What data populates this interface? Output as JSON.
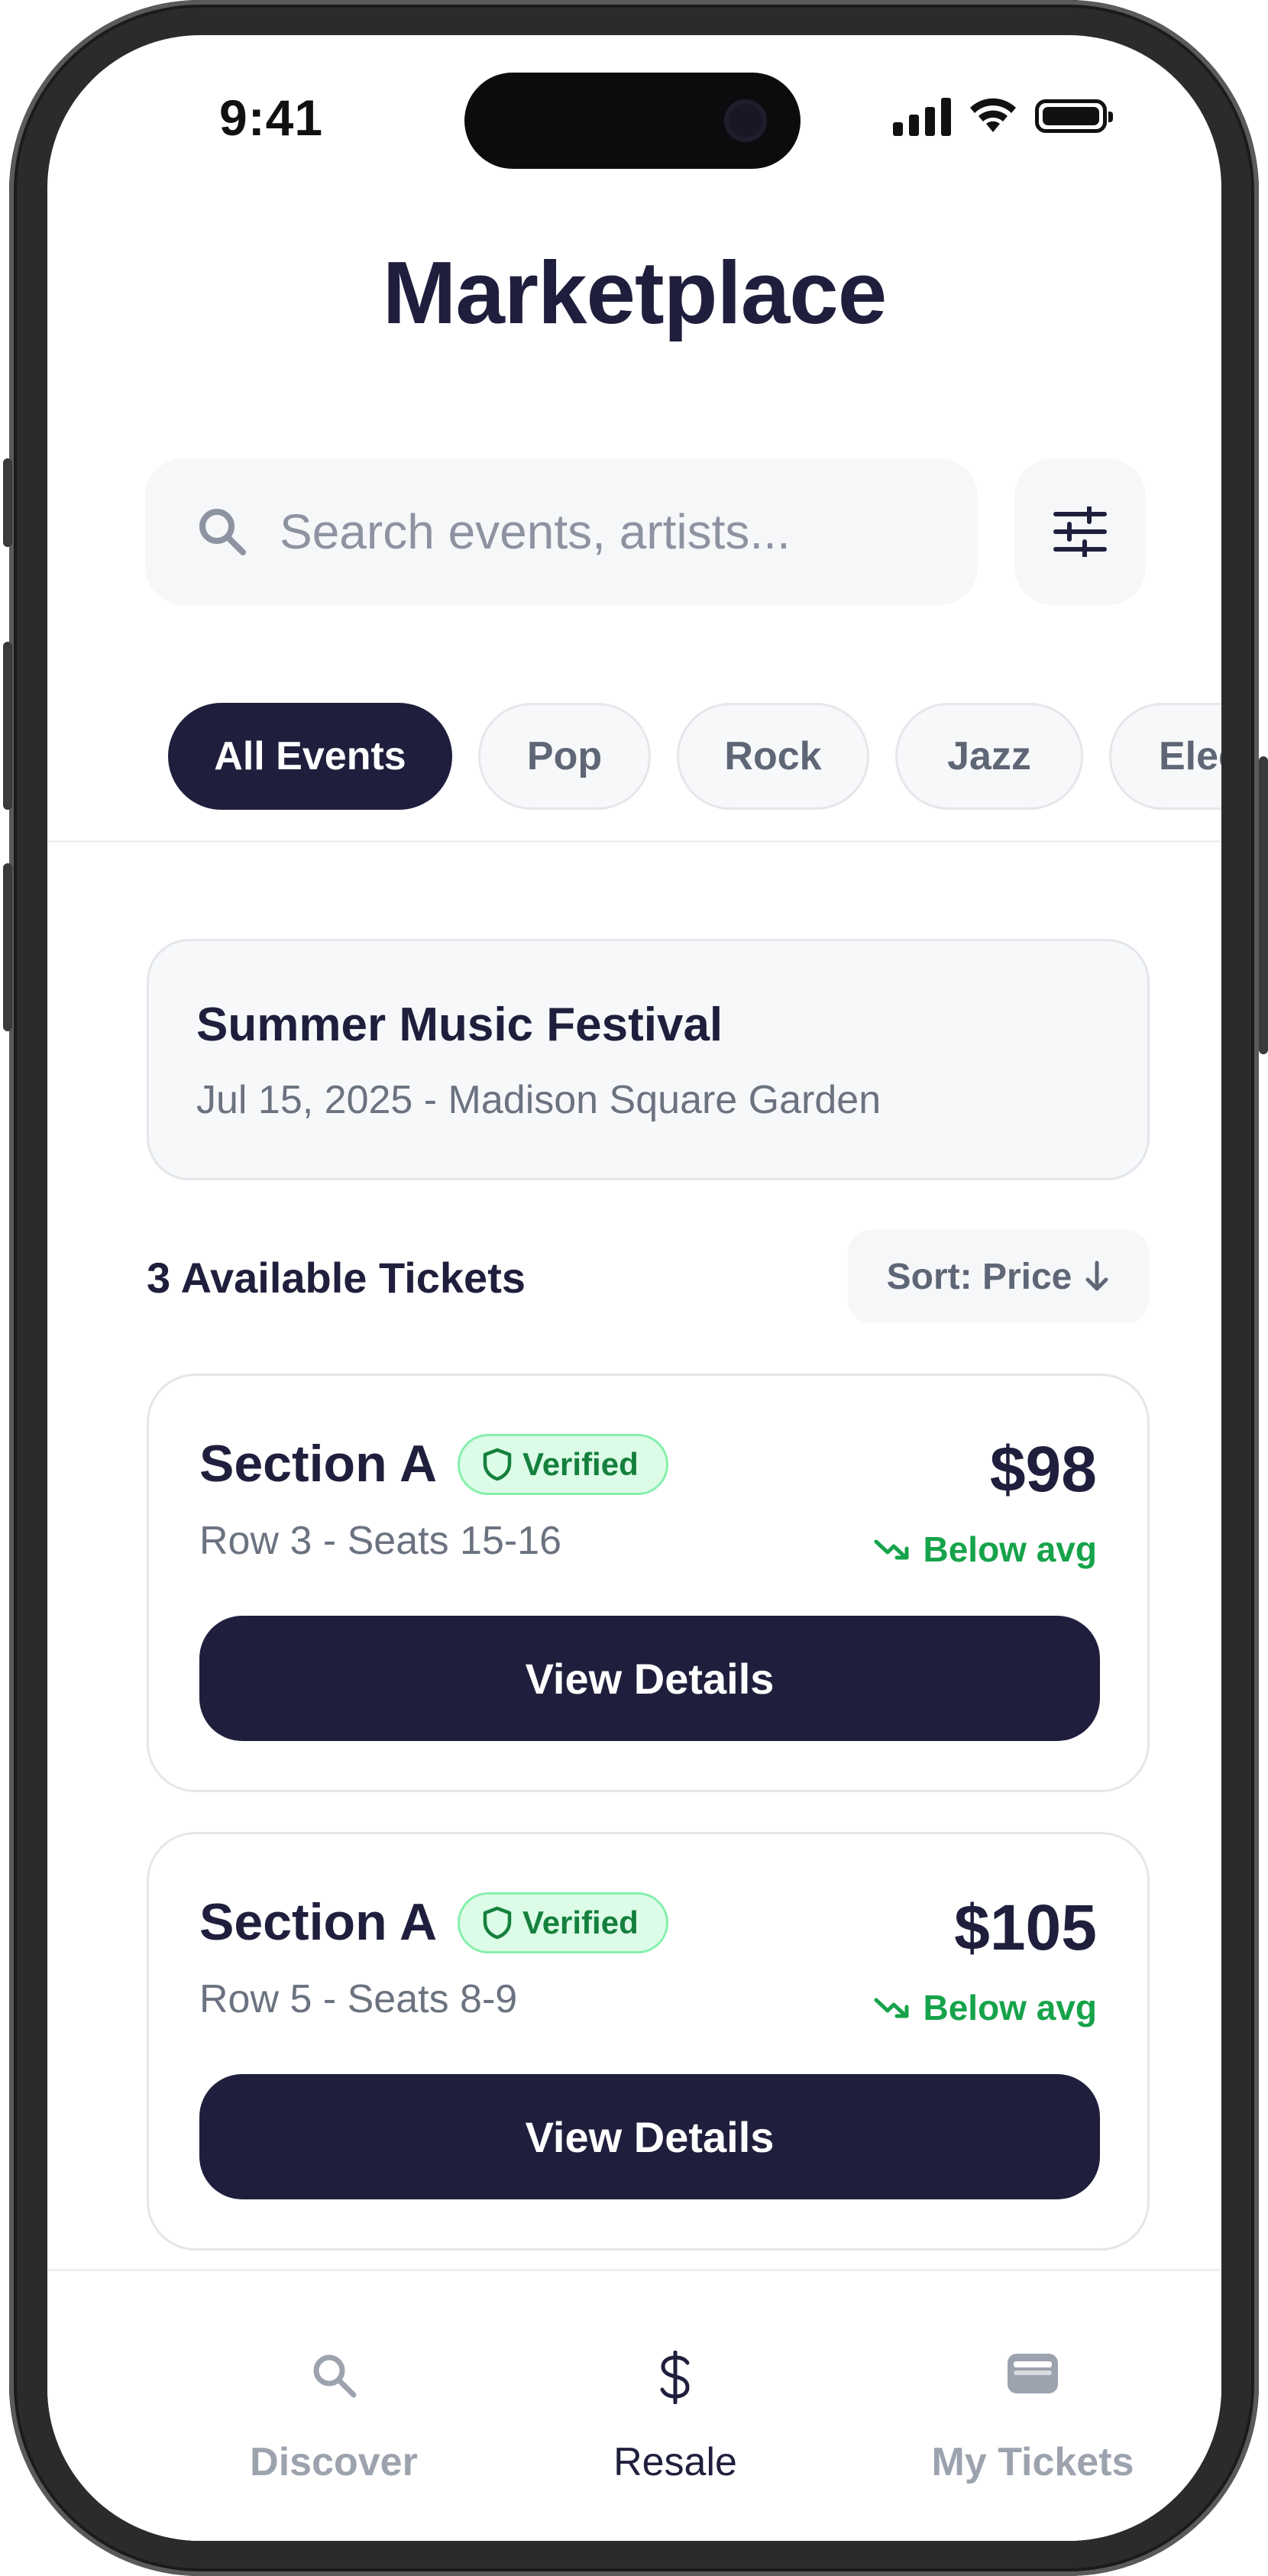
{
  "status_bar": {
    "time": "9:41"
  },
  "header": {
    "title": "Marketplace"
  },
  "search": {
    "placeholder": "Search events, artists..."
  },
  "filters": {
    "chips": [
      {
        "label": "All Events",
        "active": true
      },
      {
        "label": "Pop",
        "active": false
      },
      {
        "label": "Rock",
        "active": false
      },
      {
        "label": "Jazz",
        "active": false
      },
      {
        "label": "Electronic",
        "active": false
      }
    ]
  },
  "event": {
    "title": "Summer Music Festival",
    "subtitle": "Jul 15, 2025 - Madison Square Garden"
  },
  "listing": {
    "count_label": "3 Available Tickets",
    "sort_label": "Sort: Price"
  },
  "tickets": [
    {
      "section": "Section A",
      "badge": "Verified",
      "row": "Row 3 - Seats 15-16",
      "price": "$98",
      "trend": "Below avg",
      "button": "View Details"
    },
    {
      "section": "Section A",
      "badge": "Verified",
      "row": "Row 5 - Seats 8-9",
      "price": "$105",
      "trend": "Below avg",
      "button": "View Details"
    }
  ],
  "bottom_nav": [
    {
      "label": "Discover",
      "icon": "search-icon",
      "active": false
    },
    {
      "label": "Resale",
      "icon": "dollar-icon",
      "active": true
    },
    {
      "label": "My Tickets",
      "icon": "wallet-icon",
      "active": false
    }
  ],
  "colors": {
    "primary": "#1f1f3d",
    "success": "#16a34a",
    "muted": "#9ca3af"
  }
}
